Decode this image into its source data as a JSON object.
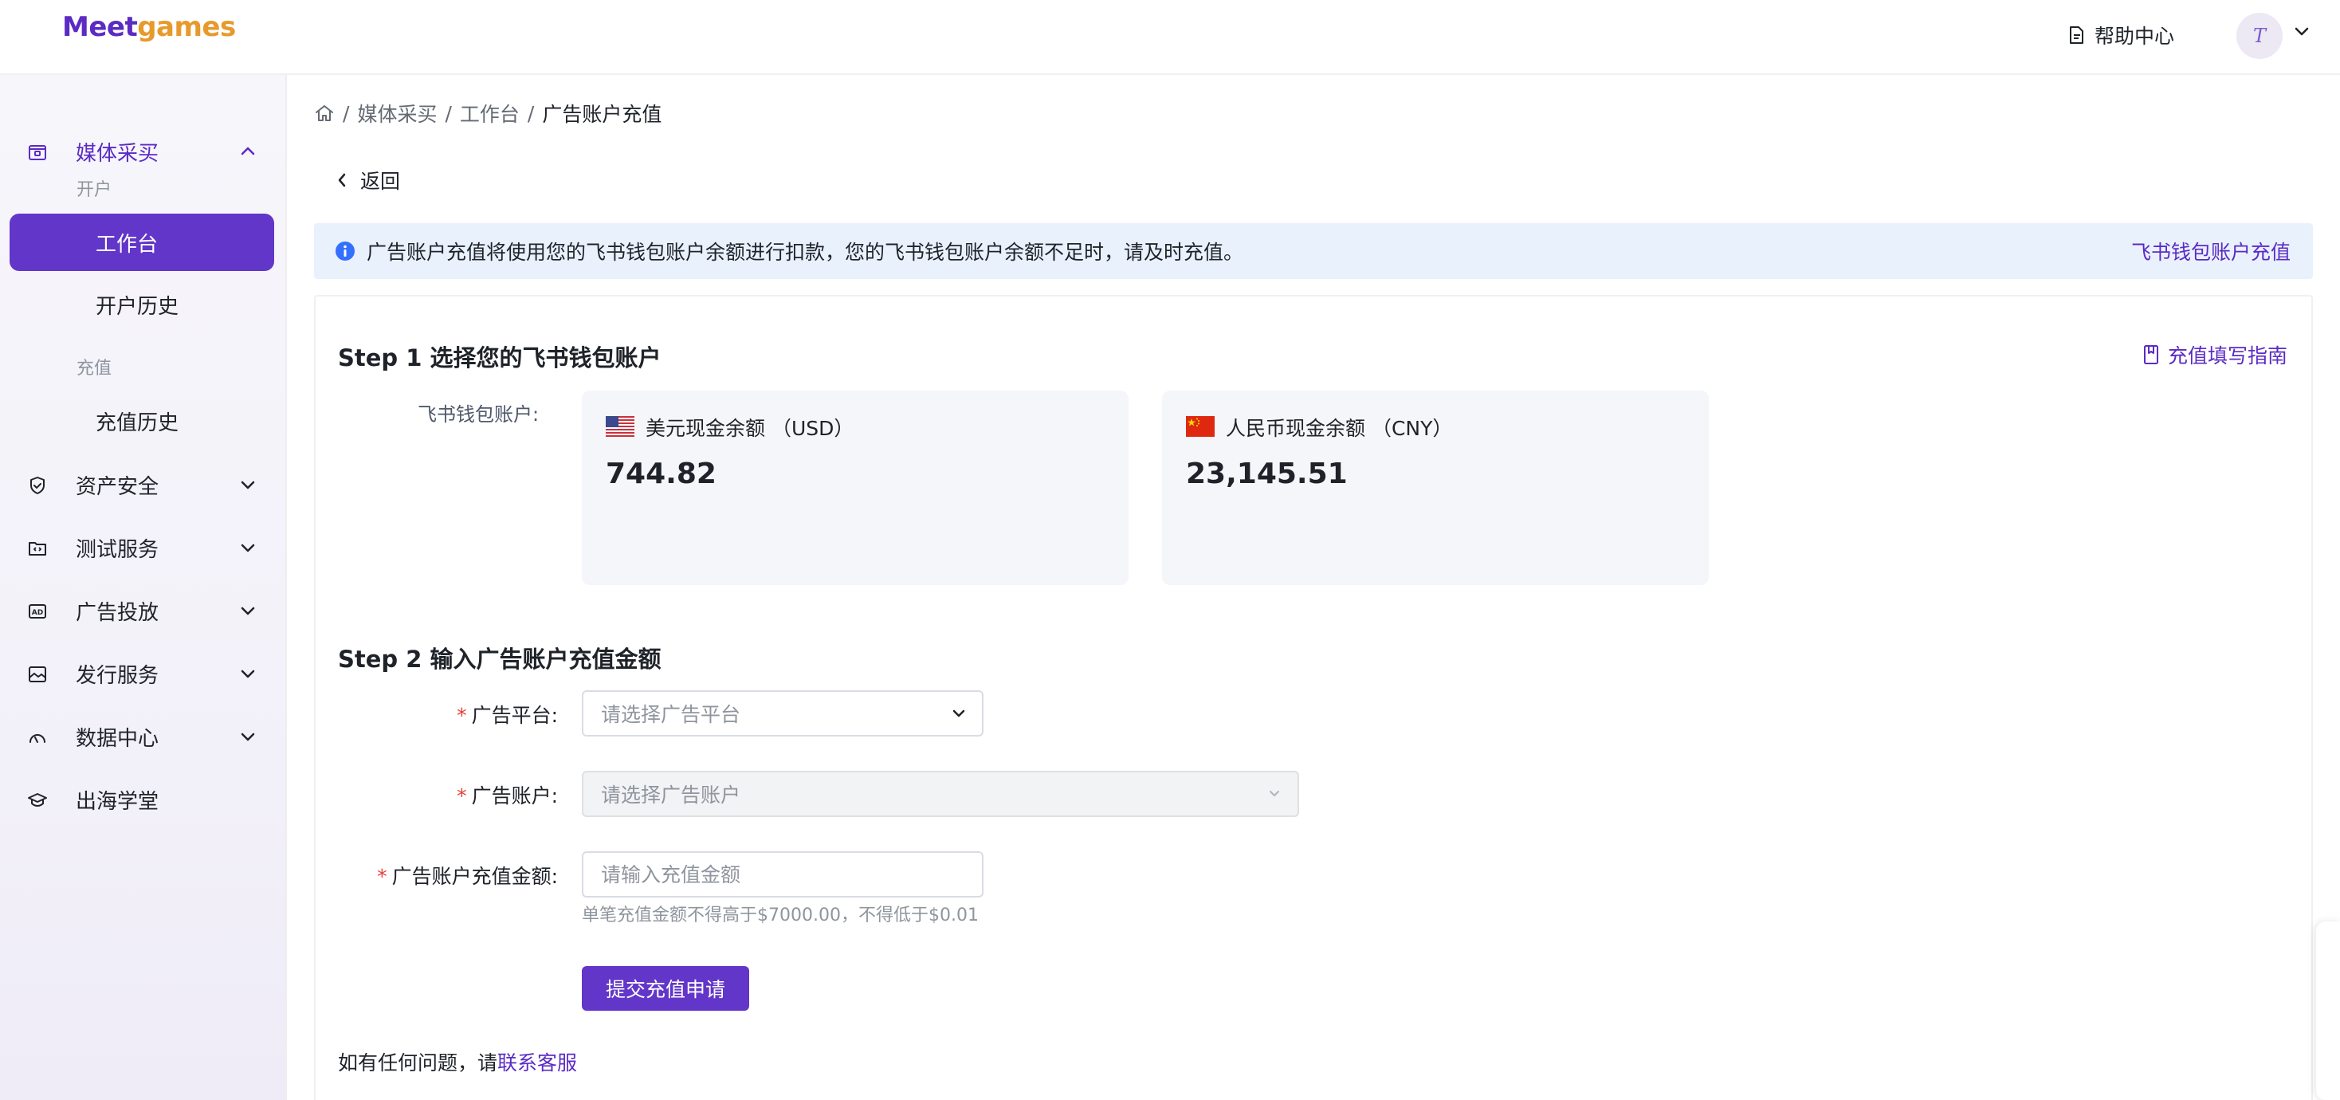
{
  "header": {
    "logo_part1": "Meet",
    "logo_part2": "games",
    "help_label": "帮助中心",
    "avatar_letter": "T"
  },
  "sidebar": {
    "media": {
      "label": "媒体采买"
    },
    "group_open": {
      "label": "开户"
    },
    "workbench": {
      "label": "工作台"
    },
    "open_history": {
      "label": "开户历史"
    },
    "group_recharge": {
      "label": "充值"
    },
    "recharge_history": {
      "label": "充值历史"
    },
    "asset_security": {
      "label": "资产安全"
    },
    "test_service": {
      "label": "测试服务"
    },
    "ad_delivery": {
      "label": "广告投放"
    },
    "publish_service": {
      "label": "发行服务"
    },
    "data_center": {
      "label": "数据中心"
    },
    "academy": {
      "label": "出海学堂"
    }
  },
  "breadcrumb": {
    "sep": "/",
    "items": [
      "媒体采买",
      "工作台",
      "广告账户充值"
    ]
  },
  "back_label": "返回",
  "notice": {
    "text": "广告账户充值将使用您的飞书钱包账户余额进行扣款，您的飞书钱包账户余额不足时，请及时充值。",
    "link": "飞书钱包账户充值"
  },
  "step1": {
    "title": "Step 1 选择您的飞书钱包账户",
    "guide": "充值填写指南",
    "wallet_label": "飞书钱包账户:",
    "usd": {
      "name": "美元现金余额 （USD）",
      "value": "744.82"
    },
    "cny": {
      "name": "人民币现金余额 （CNY）",
      "value": "23,145.51"
    }
  },
  "step2": {
    "title": "Step 2 输入广告账户充值金额",
    "required_mark": "*",
    "platform": {
      "label": "广告平台:",
      "placeholder": "请选择广告平台"
    },
    "account": {
      "label": "广告账户:",
      "placeholder": "请选择广告账户"
    },
    "amount": {
      "label": "广告账户充值金额:",
      "placeholder": "请输入充值金额"
    },
    "hint": "单笔充值金额不得高于$7000.00，不得低于$0.01",
    "submit": "提交充值申请"
  },
  "footer": {
    "prefix": "如有任何问题，请",
    "link": "联系客服"
  },
  "colors": {
    "brand": "#6236c8",
    "accent": "#e79a2c",
    "notice_bg": "#e9f1fd",
    "required": "#e5403a"
  },
  "icons": {
    "home": "home-icon",
    "back": "chevron-left-icon",
    "info": "info-circle-icon",
    "guide": "bookmark-icon",
    "help": "document-icon"
  }
}
